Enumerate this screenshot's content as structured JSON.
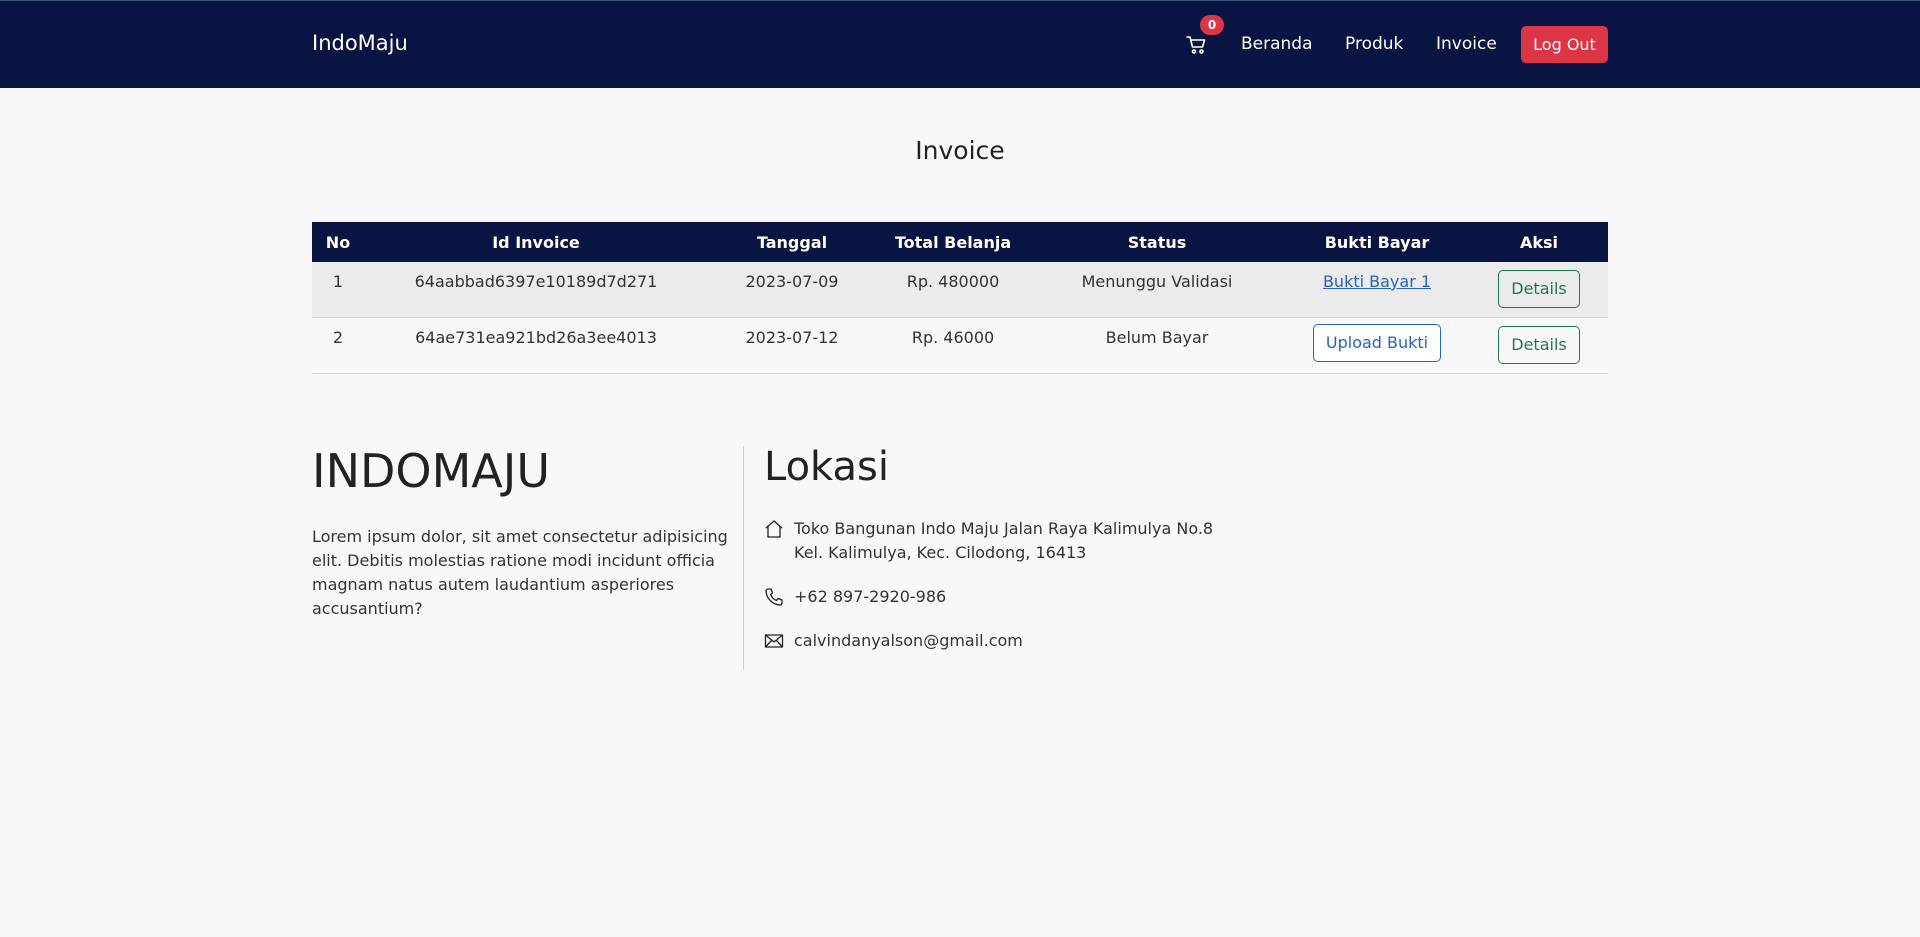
{
  "navbar": {
    "brand": "IndoMaju",
    "cart_count": "0",
    "links": [
      "Beranda",
      "Produk",
      "Invoice"
    ],
    "logout_label": "Log Out",
    "background": "#0a1442"
  },
  "page": {
    "title": "Invoice"
  },
  "table": {
    "headers": [
      "No",
      "Id Invoice",
      "Tanggal",
      "Total Belanja",
      "Status",
      "Bukti Bayar",
      "Aksi"
    ],
    "rows": [
      {
        "no": "1",
        "id": "64aabbad6397e10189d7d271",
        "tanggal": "2023-07-09",
        "total": "Rp. 480000",
        "status": "Menunggu Validasi",
        "bukti": "Bukti Bayar 1",
        "aksi": "Details"
      },
      {
        "no": "2",
        "id": "64ae731ea921bd26a3ee4013",
        "tanggal": "2023-07-12",
        "total": "Rp. 46000",
        "status": "Belum Bayar",
        "bukti": "Upload Bukti",
        "aksi": "Details"
      }
    ]
  },
  "footer": {
    "title": "INDOMAJU",
    "description": "Lorem ipsum dolor, sit amet consectetur adipisicing elit. Debitis molestias ratione modi incidunt officia magnam natus autem laudantium asperiores accusantium?",
    "lokasi_title": "Lokasi",
    "address_line1": "Toko Bangunan Indo Maju Jalan Raya Kalimulya No.8",
    "address_line2": "Kel. Kalimulya, Kec. Cilodong, 16413",
    "phone": "+62 897-2920-986",
    "email": "calvindanyalson@gmail.com"
  },
  "icons": {
    "cart": "cart-icon",
    "address": "house-icon",
    "phone": "phone-icon",
    "email": "envelope-icon"
  },
  "colors": {
    "danger": "#dc3545",
    "primary": "#2563c9",
    "success": "#1e7a4a"
  }
}
